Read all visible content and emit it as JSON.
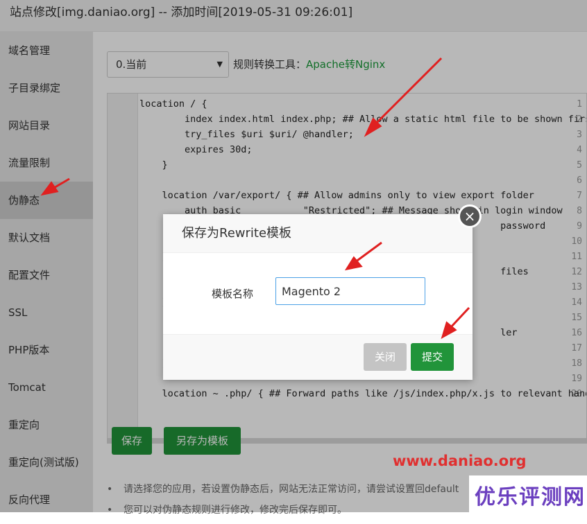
{
  "window": {
    "title": "站点修改[img.daniao.org] -- 添加时间[2019-05-31 09:26:01]"
  },
  "sidebar": {
    "items": [
      {
        "label": "域名管理"
      },
      {
        "label": "子目录绑定"
      },
      {
        "label": "网站目录"
      },
      {
        "label": "流量限制"
      },
      {
        "label": "伪静态",
        "active": true
      },
      {
        "label": "默认文档"
      },
      {
        "label": "配置文件"
      },
      {
        "label": "SSL"
      },
      {
        "label": "PHP版本"
      },
      {
        "label": "Tomcat"
      },
      {
        "label": "重定向"
      },
      {
        "label": "重定向(测试版)"
      },
      {
        "label": "反向代理"
      }
    ]
  },
  "toolbar": {
    "template_select_value": "0.当前",
    "rule_tool_label": "规则转换工具：",
    "rule_tool_link": "Apache转Nginx"
  },
  "editor": {
    "lines": [
      {
        "n": "1",
        "text": "location / {"
      },
      {
        "n": "2",
        "text": "        index index.html index.php; ## Allow a static html file to be shown first"
      },
      {
        "n": "3",
        "text": "        try_files $uri $uri/ @handler;"
      },
      {
        "n": "4",
        "text": "        expires 30d;"
      },
      {
        "n": "5",
        "text": "    }"
      },
      {
        "n": "6",
        "text": ""
      },
      {
        "n": "7",
        "text": "    location /var/export/ { ## Allow admins only to view export folder"
      },
      {
        "n": "8",
        "text": "        auth_basic           \"Restricted\"; ## Message shown in login window"
      },
      {
        "n": "9",
        "text": "                                                                password"
      },
      {
        "n": "10",
        "text": ""
      },
      {
        "n": "11",
        "text": "    }"
      },
      {
        "n": "12",
        "text": "                                                                files"
      },
      {
        "n": "13",
        "text": ""
      },
      {
        "n": "14",
        "text": "    }"
      },
      {
        "n": "15",
        "text": ""
      },
      {
        "n": "16",
        "text": "                                                                ler"
      },
      {
        "n": "17",
        "text": ""
      },
      {
        "n": "18",
        "text": "    }"
      },
      {
        "n": "19",
        "text": ""
      },
      {
        "n": "20",
        "text": "    location ~ .php/ { ## Forward paths like /js/index.php/x.js to relevant handler"
      }
    ]
  },
  "buttons": {
    "save": "保存",
    "save_as_template": "另存为模板"
  },
  "tips": [
    "请选择您的应用，若设置伪静态后，网站无法正常访问，请尝试设置回default",
    "您可以对伪静态规则进行修改，修改完后保存即可。"
  ],
  "dialog": {
    "title": "保存为Rewrite模板",
    "close_icon": "×",
    "field_label": "模板名称",
    "field_value": "Magento 2",
    "close_button": "关闭",
    "submit_button": "提交"
  },
  "overlay_text": {
    "watermark": "www.daniao.org",
    "brand": "优乐评测网"
  },
  "colors": {
    "accent_green": "#21943a",
    "annotation_red": "#e02020",
    "brand_purple": "#6b3fbf"
  }
}
